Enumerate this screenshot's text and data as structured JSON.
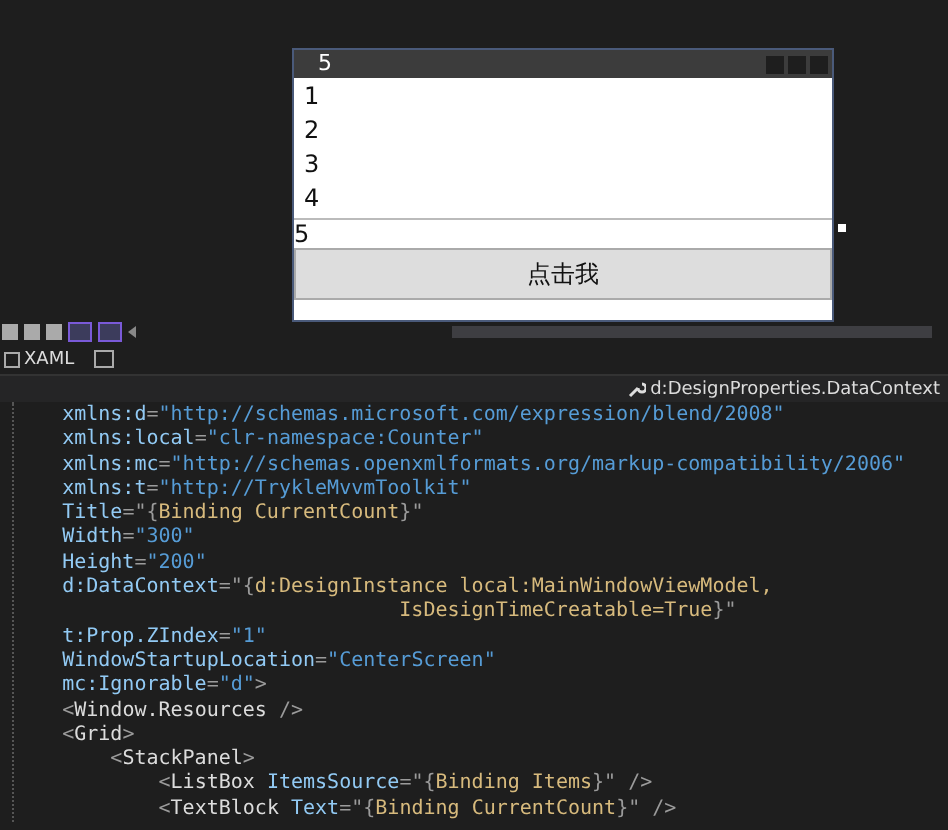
{
  "preview_window": {
    "title": "5",
    "list_items": [
      "1",
      "2",
      "3",
      "4"
    ],
    "text_value": "5",
    "button": "点击我"
  },
  "editor_tab": {
    "label": "XAML"
  },
  "member_dropdown": {
    "label": "d:DesignProperties.DataContext"
  },
  "code_lines": [
    [
      {
        "kind": "attr",
        "text": "    xmlns:d"
      },
      {
        "kind": "punct",
        "text": "="
      },
      {
        "kind": "value",
        "text": "\"http://schemas.microsoft.com/expression/blend/2008\""
      }
    ],
    [
      {
        "kind": "attr",
        "text": "    xmlns:local"
      },
      {
        "kind": "punct",
        "text": "="
      },
      {
        "kind": "value",
        "text": "\"clr-namespace:Counter\""
      }
    ],
    [
      {
        "kind": "attr",
        "text": "    xmlns:mc"
      },
      {
        "kind": "punct",
        "text": "="
      },
      {
        "kind": "value",
        "text": "\"http://schemas.openxmlformats.org/markup-compatibility/2006\""
      }
    ],
    [
      {
        "kind": "attr",
        "text": "    xmlns:t"
      },
      {
        "kind": "punct",
        "text": "="
      },
      {
        "kind": "value",
        "text": "\"http://TrykleMvvmToolkit\""
      }
    ],
    [
      {
        "kind": "attr",
        "text": "    Title"
      },
      {
        "kind": "punct",
        "text": "=\"{"
      },
      {
        "kind": "binding",
        "text": "Binding CurrentCount"
      },
      {
        "kind": "punct",
        "text": "}\""
      }
    ],
    [
      {
        "kind": "attr",
        "text": "    Width"
      },
      {
        "kind": "punct",
        "text": "="
      },
      {
        "kind": "value",
        "text": "\"300\""
      }
    ],
    [
      {
        "kind": "attr",
        "text": "    Height"
      },
      {
        "kind": "punct",
        "text": "="
      },
      {
        "kind": "value",
        "text": "\"200\""
      }
    ],
    [
      {
        "kind": "attr",
        "text": "    d:DataContext"
      },
      {
        "kind": "punct",
        "text": "=\"{"
      },
      {
        "kind": "binding",
        "text": "d:DesignInstance local:MainWindowViewModel,"
      }
    ],
    [
      {
        "kind": "binding",
        "text": "                                IsDesignTimeCreatable=True"
      },
      {
        "kind": "punct",
        "text": "}\""
      }
    ],
    [
      {
        "kind": "attr",
        "text": "    t:Prop.ZIndex"
      },
      {
        "kind": "punct",
        "text": "="
      },
      {
        "kind": "value",
        "text": "\"1\""
      }
    ],
    [
      {
        "kind": "attr",
        "text": "    WindowStartupLocation"
      },
      {
        "kind": "punct",
        "text": "="
      },
      {
        "kind": "value",
        "text": "\"CenterScreen\""
      }
    ],
    [
      {
        "kind": "attr",
        "text": "    mc:Ignorable"
      },
      {
        "kind": "punct",
        "text": "="
      },
      {
        "kind": "value",
        "text": "\"d\""
      },
      {
        "kind": "punct",
        "text": ">"
      }
    ],
    [
      {
        "kind": "punct",
        "text": "    <"
      },
      {
        "kind": "tag",
        "text": "Window.Resources"
      },
      {
        "kind": "punct",
        "text": " />"
      }
    ],
    [
      {
        "kind": "punct",
        "text": "    <"
      },
      {
        "kind": "tag",
        "text": "Grid"
      },
      {
        "kind": "punct",
        "text": ">"
      }
    ],
    [
      {
        "kind": "punct",
        "text": "        <"
      },
      {
        "kind": "tag",
        "text": "StackPanel"
      },
      {
        "kind": "punct",
        "text": ">"
      }
    ],
    [
      {
        "kind": "punct",
        "text": "            <"
      },
      {
        "kind": "tag",
        "text": "ListBox "
      },
      {
        "kind": "attr",
        "text": "ItemsSource"
      },
      {
        "kind": "punct",
        "text": "=\"{"
      },
      {
        "kind": "binding",
        "text": "Binding Items"
      },
      {
        "kind": "punct",
        "text": "}\" />"
      }
    ],
    [
      {
        "kind": "punct",
        "text": "            <"
      },
      {
        "kind": "tag",
        "text": "TextBlock "
      },
      {
        "kind": "attr",
        "text": "Text"
      },
      {
        "kind": "punct",
        "text": "=\"{"
      },
      {
        "kind": "binding",
        "text": "Binding CurrentCount"
      },
      {
        "kind": "punct",
        "text": "}\" />"
      }
    ]
  ]
}
